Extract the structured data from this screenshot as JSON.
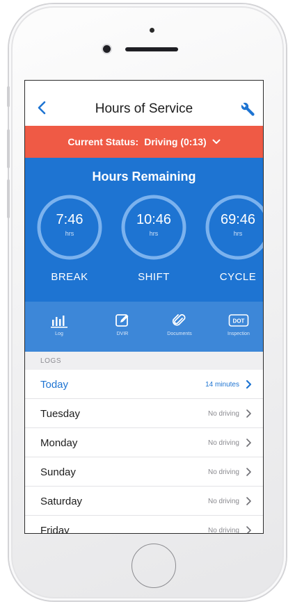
{
  "nav": {
    "title": "Hours of Service",
    "back_icon": "chevron-left-icon",
    "settings_icon": "wrench-icon"
  },
  "status": {
    "prefix": "Current Status:",
    "value": "Driving (0:13)",
    "dropdown_icon": "chevron-down-icon"
  },
  "hours": {
    "title": "Hours Remaining",
    "gauges": [
      {
        "value": "7:46",
        "unit": "hrs",
        "label": "BREAK"
      },
      {
        "value": "10:46",
        "unit": "hrs",
        "label": "SHIFT"
      },
      {
        "value": "69:46",
        "unit": "hrs",
        "label": "CYCLE"
      }
    ]
  },
  "toolbar": {
    "items": [
      {
        "label": "Log",
        "icon": "bar-chart-icon"
      },
      {
        "label": "DVIR",
        "icon": "edit-icon"
      },
      {
        "label": "Documents",
        "icon": "paperclip-icon"
      },
      {
        "label": "Inspection",
        "icon": "dot-badge-icon",
        "badge": "DOT"
      }
    ]
  },
  "logs": {
    "header": "LOGS",
    "items": [
      {
        "day": "Today",
        "status": "14 minutes"
      },
      {
        "day": "Tuesday",
        "status": "No driving"
      },
      {
        "day": "Monday",
        "status": "No driving"
      },
      {
        "day": "Sunday",
        "status": "No driving"
      },
      {
        "day": "Saturday",
        "status": "No driving"
      },
      {
        "day": "Friday",
        "status": "No driving"
      }
    ]
  },
  "colors": {
    "accent": "#1e74d2",
    "status_bar": "#ef5a45",
    "toolbar": "#3d87d8"
  }
}
